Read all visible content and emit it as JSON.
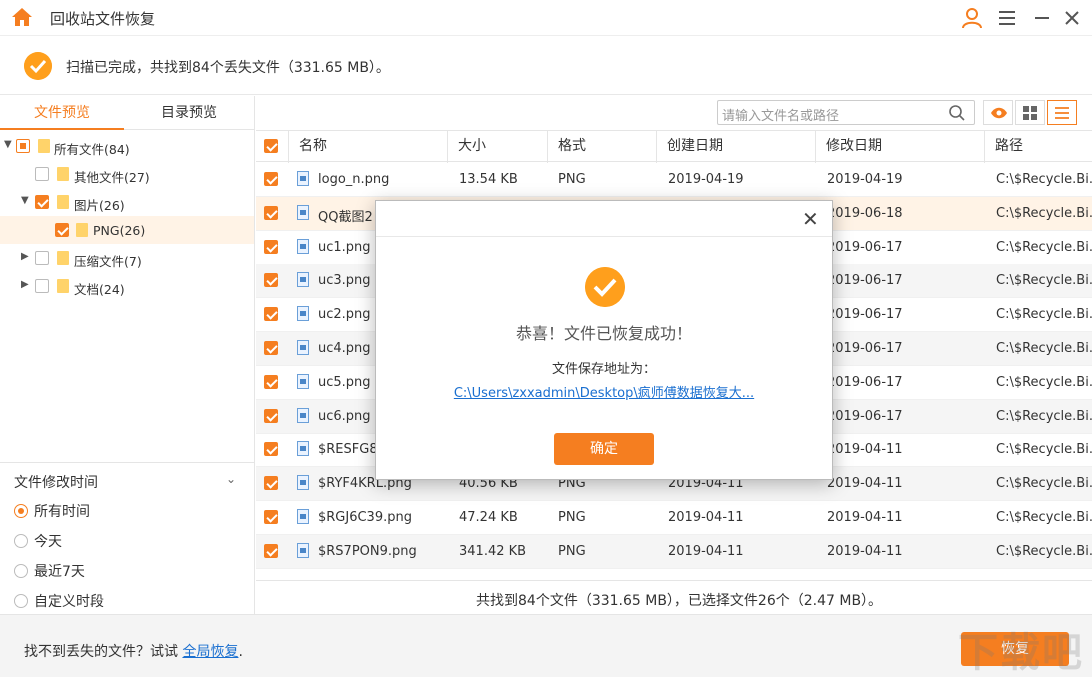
{
  "app": {
    "title": "回收站文件恢复"
  },
  "scan": {
    "message": "扫描已完成，共找到84个丢失文件（331.65 MB）。"
  },
  "tabs": [
    {
      "label": "文件预览"
    },
    {
      "label": "目录预览"
    }
  ],
  "tree": [
    {
      "label": "所有文件(84)"
    },
    {
      "label": "其他文件(27)"
    },
    {
      "label": "图片(26)"
    },
    {
      "label": "PNG(26)"
    },
    {
      "label": "压缩文件(7)"
    },
    {
      "label": "文档(24)"
    }
  ],
  "filter": {
    "title": "文件修改时间",
    "options": [
      {
        "label": "所有时间"
      },
      {
        "label": "今天"
      },
      {
        "label": "最近7天"
      },
      {
        "label": "自定义时段"
      }
    ]
  },
  "search": {
    "placeholder": "请输入文件名或路径"
  },
  "columns": [
    "名称",
    "大小",
    "格式",
    "创建日期",
    "修改日期",
    "路径"
  ],
  "rows": [
    {
      "name": "logo_n.png",
      "size": "13.54 KB",
      "format": "PNG",
      "created": "2019-04-19",
      "modified": "2019-04-19",
      "path": "C:\\$Recycle.Bi..."
    },
    {
      "name": "QQ截图2",
      "size": "",
      "format": "",
      "created": "",
      "modified": "2019-06-18",
      "path": "C:\\$Recycle.Bi..."
    },
    {
      "name": "uc1.png",
      "size": "",
      "format": "",
      "created": "",
      "modified": "2019-06-17",
      "path": "C:\\$Recycle.Bi..."
    },
    {
      "name": "uc3.png",
      "size": "",
      "format": "",
      "created": "",
      "modified": "2019-06-17",
      "path": "C:\\$Recycle.Bi..."
    },
    {
      "name": "uc2.png",
      "size": "",
      "format": "",
      "created": "",
      "modified": "2019-06-17",
      "path": "C:\\$Recycle.Bi..."
    },
    {
      "name": "uc4.png",
      "size": "",
      "format": "",
      "created": "",
      "modified": "2019-06-17",
      "path": "C:\\$Recycle.Bi..."
    },
    {
      "name": "uc5.png",
      "size": "",
      "format": "",
      "created": "",
      "modified": "2019-06-17",
      "path": "C:\\$Recycle.Bi..."
    },
    {
      "name": "uc6.png",
      "size": "",
      "format": "",
      "created": "",
      "modified": "2019-06-17",
      "path": "C:\\$Recycle.Bi..."
    },
    {
      "name": "$RESFG8I",
      "size": "",
      "format": "",
      "created": "",
      "modified": "2019-04-11",
      "path": "C:\\$Recycle.Bi..."
    },
    {
      "name": "$RYF4KRL.png",
      "size": "40.56 KB",
      "format": "PNG",
      "created": "2019-04-11",
      "modified": "2019-04-11",
      "path": "C:\\$Recycle.Bi..."
    },
    {
      "name": "$RGJ6C39.png",
      "size": "47.24 KB",
      "format": "PNG",
      "created": "2019-04-11",
      "modified": "2019-04-11",
      "path": "C:\\$Recycle.Bi..."
    },
    {
      "name": "$RS7PON9.png",
      "size": "341.42 KB",
      "format": "PNG",
      "created": "2019-04-11",
      "modified": "2019-04-11",
      "path": "C:\\$Recycle.Bi..."
    }
  ],
  "status": {
    "text": "共找到84个文件（331.65 MB），已选择文件26个（2.47 MB）。"
  },
  "footer": {
    "prompt": "找不到丢失的文件？试试 ",
    "link": "全局恢复",
    "period": ".",
    "recover": "恢复"
  },
  "dialog": {
    "message": "恭喜！文件已恢复成功！",
    "save_label": "文件保存地址为：",
    "save_path": "C:\\Users\\zxxadmin\\Desktop\\疯师傅数据恢复大...",
    "ok": "确定"
  },
  "colors": {
    "accent": "#f57e20",
    "link": "#1a6fd0"
  }
}
